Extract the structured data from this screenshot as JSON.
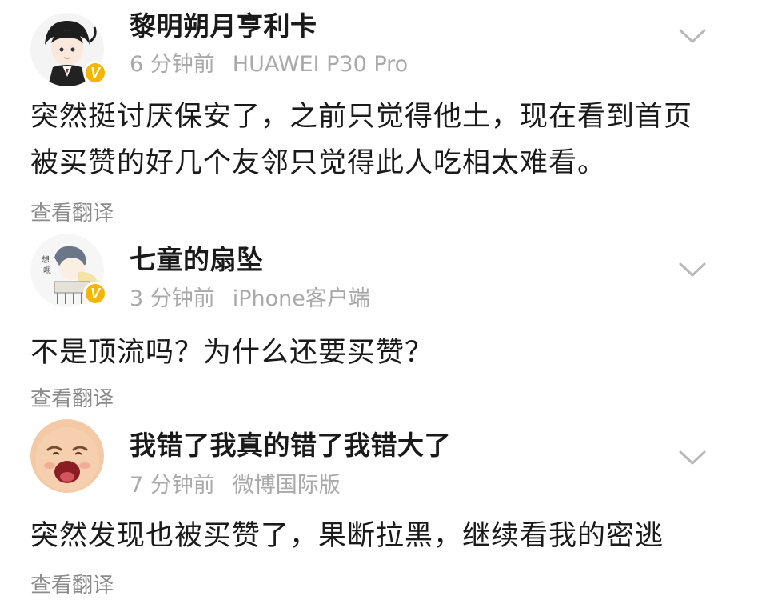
{
  "comments": [
    {
      "username": "黎明朔月亨利卡",
      "time": "6 分钟前",
      "device": "HUAWEI P30 Pro",
      "lines": [
        "突然挺讨厌保安了，之前只觉得他土，现在看到首页",
        "被买赞的好几个友邻只觉得此人吃相太难看。"
      ],
      "translate": "查看翻译",
      "avatar": "anime-character-avatar",
      "badge": "V"
    },
    {
      "username": "七童的扇坠",
      "time": "3 分钟前",
      "device": "iPhone客户端",
      "lines": [
        "不是顶流吗？为什么还要买赞？"
      ],
      "translate": "查看翻译",
      "avatar": "sketch-avatar",
      "badge": "V"
    },
    {
      "username": "我错了我真的错了我错大了",
      "time": "7 分钟前",
      "device": "微博国际版",
      "lines": [
        "突然发现也被买赞了，果断拉黑，继续看我的密逃"
      ],
      "translate": "查看翻译",
      "avatar": "crying-baby-avatar"
    }
  ],
  "icons": {
    "more": "chevron-down-icon"
  },
  "colors": {
    "badge": "#f7b500",
    "meta_text": "#a9a9a9",
    "translate_text": "#8a8a8a"
  }
}
